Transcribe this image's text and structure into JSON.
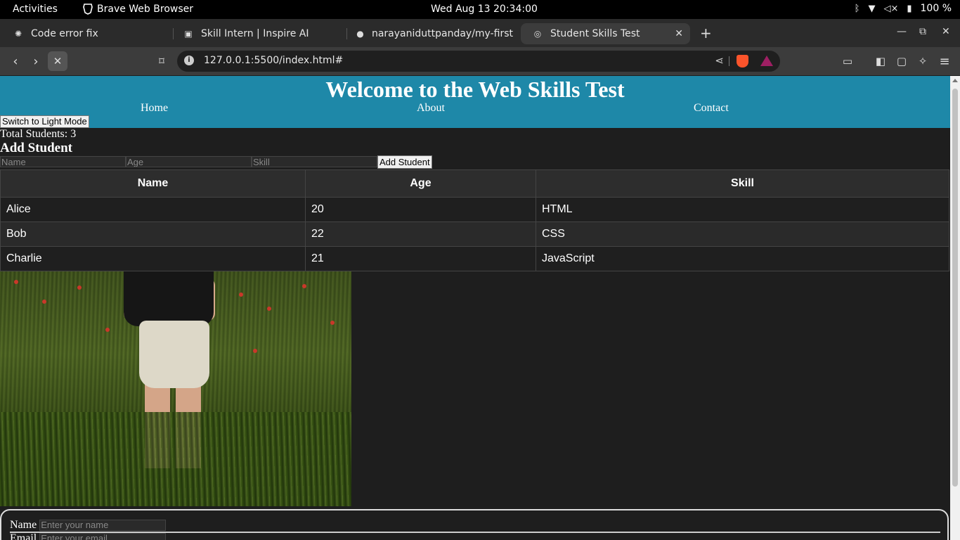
{
  "system_bar": {
    "activities": "Activities",
    "app_name": "Brave Web Browser",
    "clock": "Wed Aug 13  20:34:00",
    "battery": "100 %"
  },
  "tabs": [
    {
      "title": "Code error fix",
      "icon": "openai-icon"
    },
    {
      "title": "Skill Intern | Inspire AI",
      "icon": "site-icon"
    },
    {
      "title": "narayaniduttpanday/my-first",
      "icon": "github-icon"
    },
    {
      "title": "Student Skills Test",
      "icon": "globe-icon",
      "active": true
    }
  ],
  "toolbar": {
    "url": "127.0.0.1:5500/index.html#"
  },
  "site": {
    "title": "Welcome to the Web Skills Test",
    "nav": [
      "Home",
      "About",
      "Contact"
    ],
    "theme_button": "Switch to Light Mode",
    "total_students": "Total Students: 3",
    "add_title": "Add Student",
    "form": {
      "name_placeholder": "Name",
      "age_placeholder": "Age",
      "skill_placeholder": "Skill",
      "submit": "Add Student"
    },
    "table": {
      "headers": [
        "Name",
        "Age",
        "Skill"
      ],
      "rows": [
        [
          "Alice",
          "20",
          "HTML"
        ],
        [
          "Bob",
          "22",
          "CSS"
        ],
        [
          "Charlie",
          "21",
          "JavaScript"
        ]
      ]
    },
    "contact": {
      "name_label": "Name",
      "name_placeholder": "Enter your name",
      "email_label": "Email",
      "email_placeholder": "Enter your email"
    }
  },
  "colors": {
    "header_bg": "#1e88a8",
    "page_bg": "#1e1e1e"
  }
}
